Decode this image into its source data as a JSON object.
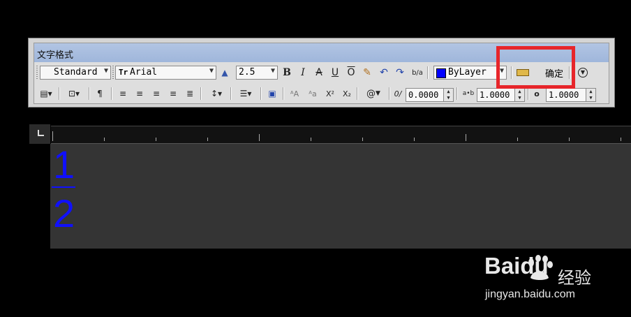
{
  "dialog": {
    "title": "文字格式",
    "style": {
      "value": "Standard"
    },
    "font": {
      "value": "Arial",
      "prefix": "Tr"
    },
    "height": {
      "value": "2.5"
    },
    "format_buttons": {
      "bold": "B",
      "italic": "I",
      "strikethrough": "A",
      "underline": "U",
      "overline": "O",
      "undo": "↶",
      "redo": "↷",
      "stack": "b/a"
    },
    "color": {
      "value": "ByLayer",
      "swatch": "#0000ff"
    },
    "ok_label": "确定",
    "row2": {
      "symbol": "@",
      "superscript": "X²",
      "subscript": "X₂",
      "oblique_angle": "0.0000",
      "tracking": "1.0000",
      "width_factor": "1.0000",
      "tracking_label": "a•b",
      "oblique_label": "0/"
    }
  },
  "editor": {
    "numerator": "1",
    "denominator": "2",
    "text_color": "#1010ff"
  },
  "watermark": {
    "logo": "Baidu",
    "cn": "经验",
    "url": "jingyan.baidu.com"
  },
  "colors": {
    "highlight": "#e7252a",
    "titlebar": "#a9bfe0"
  }
}
